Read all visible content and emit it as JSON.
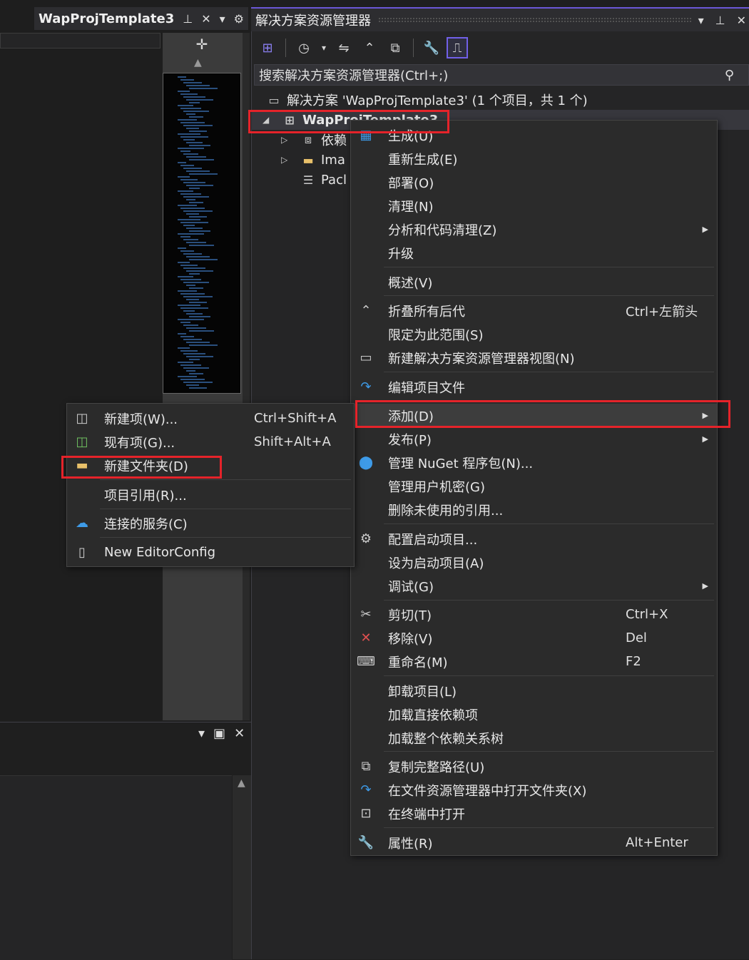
{
  "editor": {
    "tab_title": "WapProjTemplate3"
  },
  "solution_explorer": {
    "title": "解决方案资源管理器",
    "search_placeholder": "搜索解决方案资源管理器(Ctrl+;)",
    "tree": {
      "solution": "解决方案 'WapProjTemplate3' (1 个项目，共 1 个)",
      "project": "WapProjTemplate3",
      "children": [
        "依赖",
        "Ima",
        "Pacl"
      ]
    }
  },
  "context_menu": {
    "items": [
      {
        "label": "生成(U)",
        "icon": "build-icon"
      },
      {
        "label": "重新生成(E)"
      },
      {
        "label": "部署(O)"
      },
      {
        "label": "清理(N)"
      },
      {
        "label": "分析和代码清理(Z)",
        "submenu": true
      },
      {
        "label": "升级"
      },
      {
        "label": "概述(V)"
      },
      {
        "label": "折叠所有后代",
        "shortcut": "Ctrl+左箭头"
      },
      {
        "label": "限定为此范围(S)"
      },
      {
        "label": "新建解决方案资源管理器视图(N)"
      },
      {
        "label": "编辑项目文件"
      },
      {
        "label": "添加(D)",
        "submenu": true,
        "highlighted": true
      },
      {
        "label": "发布(P)",
        "submenu": true
      },
      {
        "label": "管理 NuGet 程序包(N)..."
      },
      {
        "label": "管理用户机密(G)"
      },
      {
        "label": "删除未使用的引用..."
      },
      {
        "label": "配置启动项目..."
      },
      {
        "label": "设为启动项目(A)"
      },
      {
        "label": "调试(G)",
        "submenu": true
      },
      {
        "label": "剪切(T)",
        "shortcut": "Ctrl+X"
      },
      {
        "label": "移除(V)",
        "shortcut": "Del"
      },
      {
        "label": "重命名(M)",
        "shortcut": "F2"
      },
      {
        "label": "卸载项目(L)"
      },
      {
        "label": "加载直接依赖项"
      },
      {
        "label": "加载整个依赖关系树"
      },
      {
        "label": "复制完整路径(U)"
      },
      {
        "label": "在文件资源管理器中打开文件夹(X)"
      },
      {
        "label": "在终端中打开"
      },
      {
        "label": "属性(R)",
        "shortcut": "Alt+Enter"
      }
    ]
  },
  "add_submenu": {
    "items": [
      {
        "label": "新建项(W)...",
        "shortcut": "Ctrl+Shift+A"
      },
      {
        "label": "现有项(G)...",
        "shortcut": "Shift+Alt+A"
      },
      {
        "label": "新建文件夹(D)"
      },
      {
        "label": "项目引用(R)..."
      },
      {
        "label": "连接的服务(C)"
      },
      {
        "label": "New EditorConfig"
      }
    ]
  },
  "colors": {
    "highlight_box": "#e5232a",
    "accent": "#6b58d6"
  }
}
